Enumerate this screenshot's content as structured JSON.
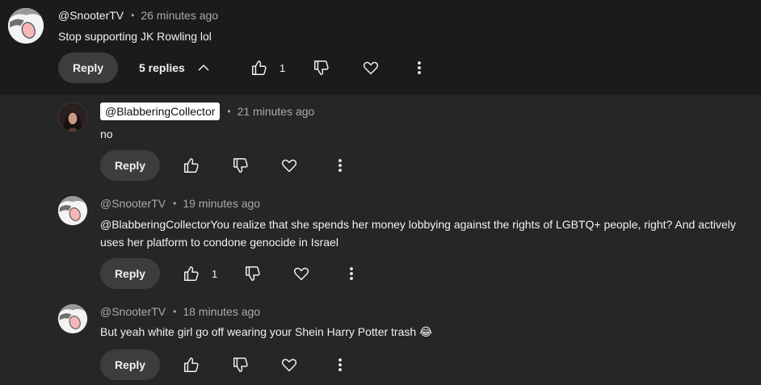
{
  "thread": {
    "author": "@SnooterTV",
    "time": "26 minutes ago",
    "text": "Stop supporting JK Rowling lol",
    "reply_label": "Reply",
    "replies_label": "5 replies",
    "like_count": "1"
  },
  "replies": [
    {
      "author": "@BlabberingCollector",
      "time": "21 minutes ago",
      "text": "no",
      "reply_label": "Reply"
    },
    {
      "author": "@SnooterTV",
      "time": "19 minutes ago",
      "text": "@BlabberingCollectorYou realize that she spends her money lobbying against the rights of LGBTQ+ people, right? And actively uses her platform to condone genocide in Israel",
      "reply_label": "Reply",
      "like_count": "1"
    },
    {
      "author": "@SnooterTV",
      "time": "18 minutes ago",
      "text": "But yeah white girl go off wearing your Shein Harry Potter trash 😂",
      "reply_label": "Reply"
    }
  ],
  "separator": "•",
  "colors": {
    "top_background": "#1b1b1b",
    "page_background": "#262626",
    "button_background": "#3d3d3d",
    "secondary_text": "#aaaaaa"
  }
}
